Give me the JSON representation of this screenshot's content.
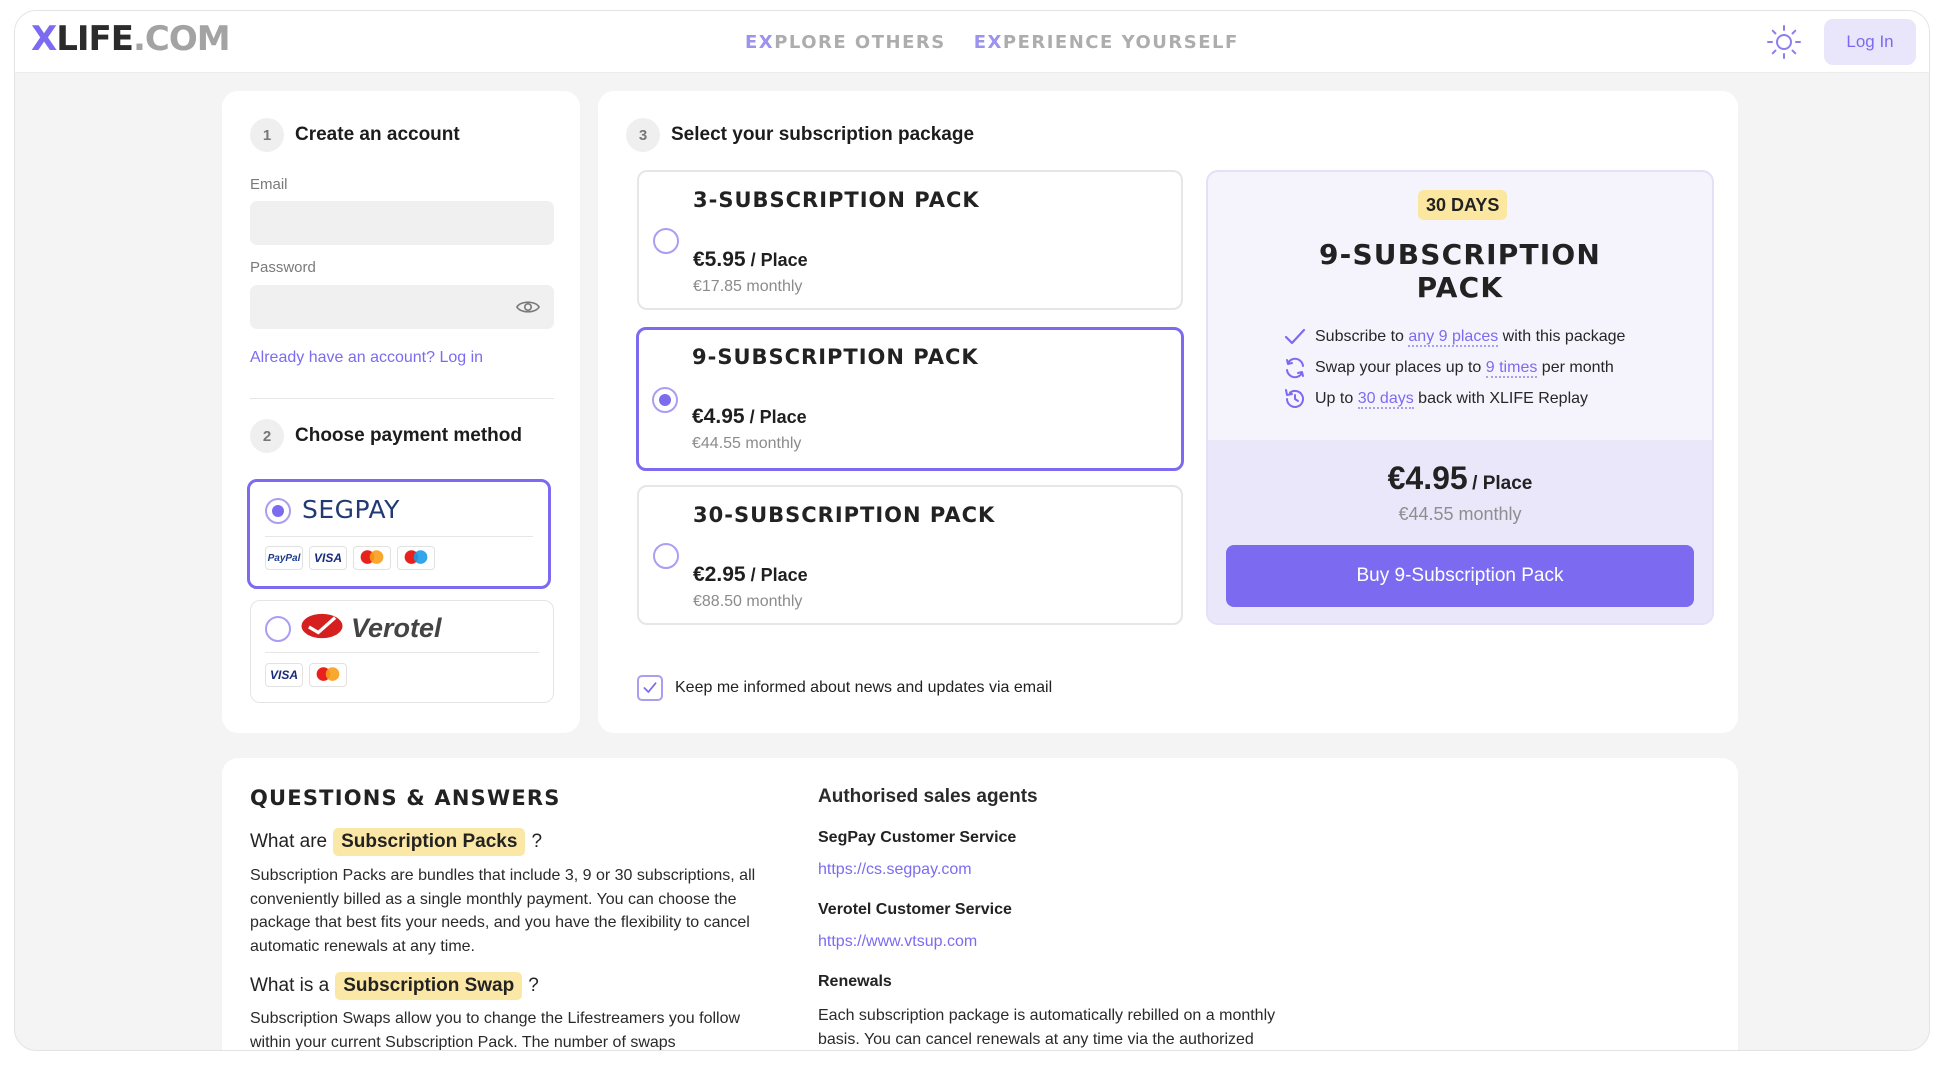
{
  "header": {
    "logo_x": "X",
    "logo_main": "LIFE",
    "logo_domain": ".COM",
    "nav": [
      {
        "first": "EX",
        "rest": "PLORE OTHERS"
      },
      {
        "first": "EX",
        "rest": "PERIENCE YOURSELF"
      }
    ],
    "theme_icon": "sun-icon",
    "login_label": "Log In"
  },
  "account": {
    "step": "1",
    "title": "Create an account",
    "email_label": "Email",
    "email_value": "",
    "password_label": "Password",
    "password_value": "",
    "eye_icon": "eye-icon",
    "login_link": "Already have an account? Log in"
  },
  "payment": {
    "step": "2",
    "title": "Choose payment method",
    "methods": [
      {
        "name": "SEGPAY",
        "selected": true,
        "cards": [
          "PayPal",
          "VISA",
          "mastercard",
          "maestro"
        ]
      },
      {
        "name": "Verotel",
        "selected": false,
        "cards": [
          "VISA",
          "mastercard"
        ]
      }
    ]
  },
  "packages": {
    "step": "3",
    "title": "Select your subscription package",
    "items": [
      {
        "title": "3-SUBSCRIPTION PACK",
        "price": "€5.95",
        "per": " / Place",
        "monthly": "€17.85 monthly",
        "selected": false
      },
      {
        "title": "9-SUBSCRIPTION PACK",
        "price": "€4.95",
        "per": " / Place",
        "monthly": "€44.55 monthly",
        "selected": true
      },
      {
        "title": "30-SUBSCRIPTION PACK",
        "price": "€2.95",
        "per": " / Place",
        "monthly": "€88.50 monthly",
        "selected": false
      }
    ]
  },
  "summary": {
    "badge": "30 DAYS",
    "title_line1": "9-SUBSCRIPTION",
    "title_line2": "PACK",
    "features": [
      {
        "icon": "check-icon",
        "pre": "Subscribe to ",
        "hl": "any 9 places",
        "post": " with this package"
      },
      {
        "icon": "swap-icon",
        "pre": "Swap your places up to ",
        "hl": "9 times",
        "post": " per month"
      },
      {
        "icon": "history-icon",
        "pre": "Up to ",
        "hl": "30 days",
        "post": " back with XLIFE Replay"
      }
    ],
    "price": "€4.95",
    "per": "/ Place",
    "monthly": "€44.55 monthly",
    "buy_label": "Buy 9-Subscription Pack"
  },
  "newsletter": {
    "checked": true,
    "label": "Keep me informed about news and updates via email"
  },
  "qa": {
    "title": "QUESTIONS & ANSWERS",
    "q1_pre": "What are",
    "q1_hl": "Subscription Packs",
    "q1_post": "?",
    "a1": "Subscription Packs are bundles that include 3, 9 or 30 subscriptions, all conveniently billed as a single monthly payment. You can choose the package that best fits your needs, and you have the flexibility to cancel automatic renewals at any time.",
    "q2_pre": "What is a",
    "q2_hl": "Subscription Swap",
    "q2_post": "?",
    "a2": "Subscription Swaps allow you to change the Lifestreamers you follow within your current Subscription Pack. The number of swaps"
  },
  "agents": {
    "title": "Authorised sales agents",
    "segpay_label": "SegPay Customer Service",
    "segpay_url": "https://cs.segpay.com",
    "verotel_label": "Verotel Customer Service",
    "verotel_url": "https://www.vtsup.com",
    "renewals_title": "Renewals",
    "renewals_text": "Each subscription package is automatically rebilled on a monthly basis. You can cancel renewals at any time via the authorized"
  }
}
